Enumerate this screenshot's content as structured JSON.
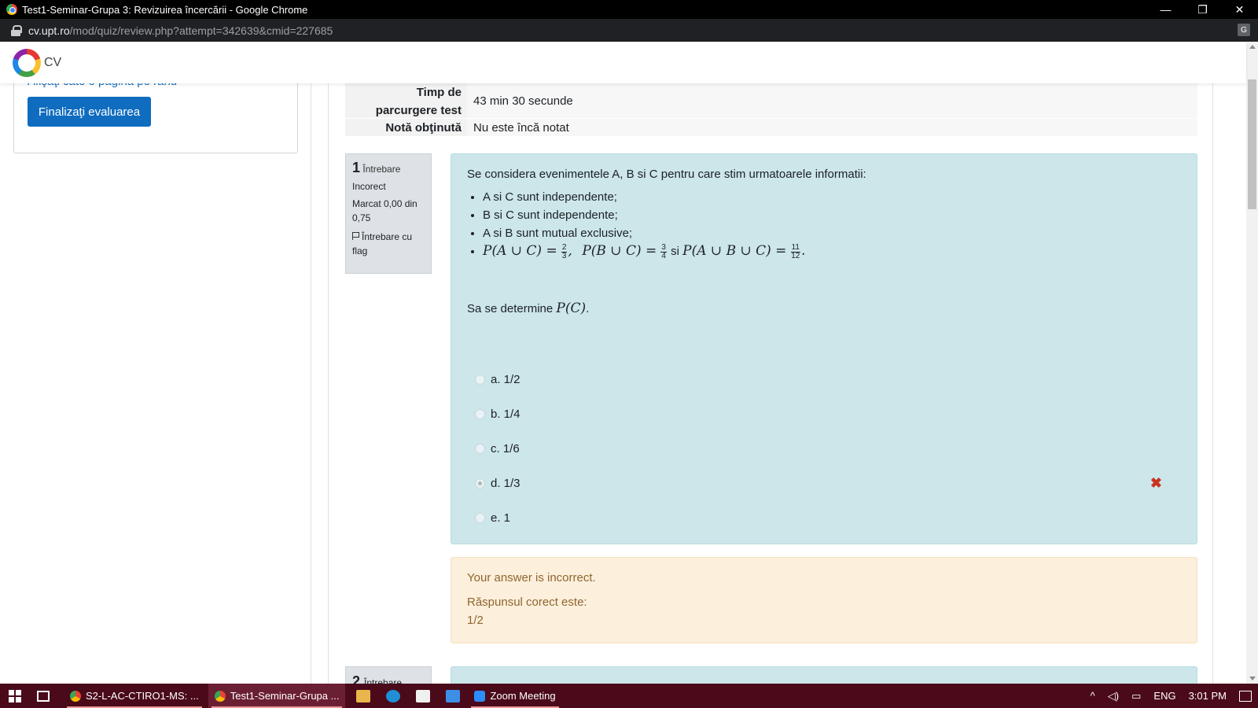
{
  "browser": {
    "window_title": "Test1-Seminar-Grupa 3: Revizuirea încercării - Google Chrome",
    "url_host": "cv.upt.ro",
    "url_path": "/mod/quiz/review.php?attempt=342639&cmid=227685",
    "controls": {
      "minimize": "—",
      "restore": "❐",
      "close": "✕"
    }
  },
  "site": {
    "name": "CV"
  },
  "drawer": {
    "one_page_link": "Afişaţi câte o pagină pe rând",
    "finish_button": "Finalizaţi evaluarea"
  },
  "summary": {
    "rows": [
      {
        "label": "Timp de parcurgere test",
        "value": "43 min 30 secunde"
      },
      {
        "label": "Notă obţinută",
        "value": "Nu este încă notat"
      }
    ]
  },
  "question": {
    "number": "1",
    "word": "Întrebare",
    "state": "Incorect",
    "grade": "Marcat 0,00 din 0,75",
    "flag_label": "Întrebare cu flag",
    "intro": "Se considera evenimentele A, B si C pentru care stim urmatoarele informatii:",
    "bullets": [
      "A si C sunt independente;",
      "B si C sunt independente;",
      "A si B sunt mutual exclusive;"
    ],
    "formula": {
      "p1": "P(A ∪ C) =",
      "f1_num": "2",
      "f1_den": "3",
      "p2": "P(B ∪ C) =",
      "f2_num": "3",
      "f2_den": "4",
      "si": "si",
      "p3": "P(A ∪ B ∪ C) =",
      "f3_num": "11",
      "f3_den": "12"
    },
    "prompt_text": "Sa se determine",
    "prompt_math": "P(C)",
    "answers": [
      {
        "label": "a. 1/2",
        "checked": false
      },
      {
        "label": "b. 1/4",
        "checked": false
      },
      {
        "label": "c. 1/6",
        "checked": false
      },
      {
        "label": "d. 1/3",
        "checked": true
      },
      {
        "label": "e. 1",
        "checked": false
      }
    ],
    "incorrect_mark": "✖"
  },
  "feedback": {
    "status": "Your answer is incorrect.",
    "right_answer_label": "Răspunsul corect este:",
    "right_answer": "1/2"
  },
  "next_question": {
    "number": "2",
    "word": "Întrebare"
  },
  "taskbar": {
    "items": [
      {
        "label": "S2-L-AC-CTIRO1-MS: ...",
        "active": false
      },
      {
        "label": "Test1-Seminar-Grupa ...",
        "active": true
      },
      {
        "label": "Zoom Meeting",
        "active": false
      }
    ],
    "language": "ENG",
    "time": "3:01 PM"
  },
  "colors": {
    "primary": "#0f6cbf",
    "question_bg": "#cce6ea",
    "feedback_bg": "#fcefdc",
    "incorrect": "#ca3120",
    "taskbar": "#4a0a1a"
  }
}
